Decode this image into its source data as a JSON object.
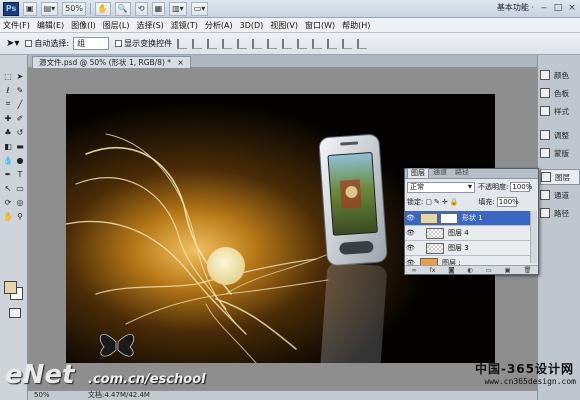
{
  "appbar": {
    "logo": "Ps",
    "zoom": "50%",
    "workspace": "基本功能 ·",
    "window_controls": [
      "‒",
      "□",
      "×"
    ]
  },
  "menu": [
    "文件(F)",
    "编辑(E)",
    "图像(I)",
    "图层(L)",
    "选择(S)",
    "滤镜(T)",
    "分析(A)",
    "3D(D)",
    "视图(V)",
    "窗口(W)",
    "帮助(H)"
  ],
  "options": {
    "auto_select_label": "自动选择:",
    "auto_select_value": "组",
    "show_transform_label": "显示变换控件"
  },
  "document": {
    "tab_title": "源文件.psd @ 50% (形状 1, RGB/8) *",
    "close": "×"
  },
  "status": {
    "zoom": "50%",
    "doc_info": "文档:4.47M/42.4M"
  },
  "dock": {
    "items": [
      "颜色",
      "色板",
      "样式",
      "调整",
      "蒙版",
      "图层",
      "通道",
      "路径"
    ],
    "active_index": 5
  },
  "layers_panel": {
    "tabs": [
      "图层",
      "通道",
      "路径"
    ],
    "blend_mode": "正常",
    "opacity_label": "不透明度:",
    "opacity_value": "100%",
    "lock_label": "锁定:",
    "fill_label": "填充:",
    "fill_value": "100%",
    "layers": [
      {
        "name": "形状 1",
        "selected": true
      },
      {
        "name": "图层 4",
        "selected": false
      },
      {
        "name": "图层 3",
        "selected": false
      },
      {
        "name": "图层 :",
        "selected": false
      }
    ]
  },
  "watermark": {
    "site_cn": "中国-365设计网",
    "site_url": "www.cn365design.com",
    "enet_logo": "eNet",
    "enet_url": ".com.cn/eschool"
  },
  "colors": {
    "foreground": "#e6d6a3",
    "selected_layer": "#3a67c4",
    "glow": "#d49a2a"
  }
}
